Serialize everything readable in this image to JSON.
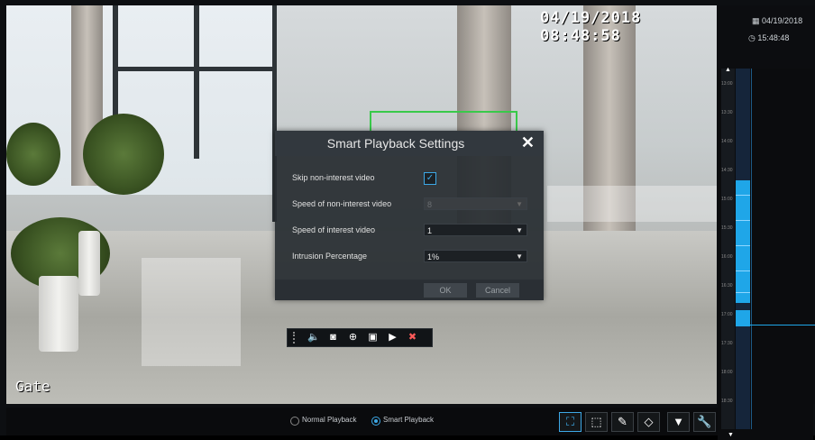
{
  "video": {
    "timestamp": "04/19/2018 08:48:58",
    "channel_name": "Gate"
  },
  "modal": {
    "title": "Smart Playback Settings",
    "close_icon": "close-icon",
    "rows": [
      {
        "label": "Skip non-interest video",
        "type": "checkbox",
        "checked": true
      },
      {
        "label": "Speed of non-interest video",
        "type": "select",
        "value": "8",
        "disabled": true
      },
      {
        "label": "Speed of interest video",
        "type": "select",
        "value": "1",
        "disabled": false
      },
      {
        "label": "Intrusion Percentage",
        "type": "select",
        "value": "1%",
        "disabled": false
      }
    ],
    "ok_label": "OK",
    "cancel_label": "Cancel"
  },
  "float_toolbar": {
    "icons": [
      "grip-icon",
      "mute-icon",
      "snapshot-icon",
      "zoom-icon",
      "bookmark-icon",
      "record-icon",
      "delete-icon"
    ]
  },
  "right_panel": {
    "date": "04/19/2018",
    "time": "15:48:48",
    "ticks": [
      "13:00",
      "13:30",
      "14:00",
      "14:30",
      "15:00",
      "15:30",
      "16:00",
      "16:30",
      "17:00",
      "17:30",
      "18:00",
      "18:30"
    ]
  },
  "bottom_bar": {
    "normal_playback_label": "Normal Playback",
    "smart_playback_label": "Smart Playback",
    "selected_mode": "Smart Playback",
    "tool_icons": [
      "smart-select-icon",
      "region-select-icon",
      "line-draw-icon",
      "diamond-icon",
      "filter-icon",
      "settings-wrench-icon"
    ]
  },
  "colors": {
    "accent": "#3da8e6",
    "track_fill": "#1fa6e8",
    "detection_box": "#39c94a"
  }
}
